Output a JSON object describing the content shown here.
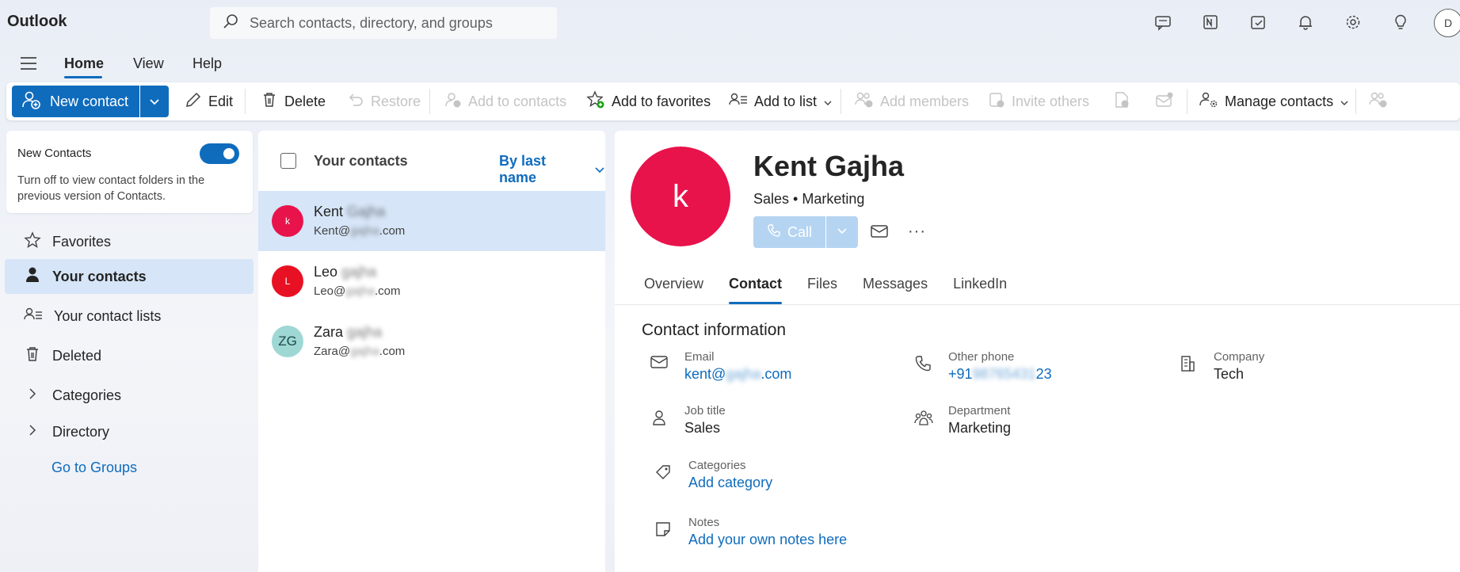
{
  "app": {
    "title": "Outlook"
  },
  "search": {
    "placeholder": "Search contacts, directory, and groups"
  },
  "topbar": {
    "icons": [
      "feedback-icon",
      "onenote-icon",
      "tasks-icon",
      "bell-icon",
      "gear-icon",
      "lightbulb-icon"
    ],
    "avatar_initial": "D"
  },
  "menu": {
    "tabs": [
      "Home",
      "View",
      "Help"
    ],
    "active": "Home"
  },
  "ribbon": {
    "new_contact": "New contact",
    "edit": "Edit",
    "delete": "Delete",
    "restore": "Restore",
    "add_to_contacts": "Add to contacts",
    "add_to_favorites": "Add to favorites",
    "add_to_list": "Add to list",
    "add_members": "Add members",
    "invite_others": "Invite others",
    "manage_contacts": "Manage contacts"
  },
  "left": {
    "new_contacts_title": "New Contacts",
    "new_contacts_desc": "Turn off to view contact folders in the previous version of Contacts.",
    "toggle_on": true,
    "nav": [
      {
        "label": "Favorites",
        "icon": "star-icon"
      },
      {
        "label": "Your contacts",
        "icon": "person-icon",
        "active": true
      },
      {
        "label": "Your contact lists",
        "icon": "people-list-icon"
      },
      {
        "label": "Deleted",
        "icon": "trash-icon"
      },
      {
        "label": "Categories",
        "icon": "chevron-right-icon"
      },
      {
        "label": "Directory",
        "icon": "chevron-right-icon"
      }
    ],
    "groups_link": "Go to Groups"
  },
  "list": {
    "title": "Your contacts",
    "sort": "By last name",
    "contacts": [
      {
        "initials": "k",
        "first": "Kent",
        "last": "Gajha",
        "email_user": "Kent@",
        "email_domain": "gajha",
        "email_tld": ".com",
        "color": "#e8134b",
        "selected": true
      },
      {
        "initials": "L",
        "first": "Leo",
        "last": "gajha",
        "email_user": "Leo@",
        "email_domain": "gajha",
        "email_tld": ".com",
        "color": "#e81123"
      },
      {
        "initials": "ZG",
        "first": "Zara",
        "last": "gajha",
        "email_user": "Zara@",
        "email_domain": "gajha",
        "email_tld": ".com",
        "color": "#9fd7d4"
      }
    ]
  },
  "detail": {
    "avatar_initial": "k",
    "name": "Kent Gajha",
    "role": "Sales • Marketing",
    "call": "Call",
    "more": "···",
    "tabs": [
      "Overview",
      "Contact",
      "Files",
      "Messages",
      "LinkedIn"
    ],
    "active_tab": "Contact",
    "section_title": "Contact information",
    "email_label": "Email",
    "email_user": "kent@",
    "email_domain": "gajha",
    "email_tld": ".com",
    "phone_label": "Other phone",
    "phone_prefix": "+91",
    "phone_mid": "98765431",
    "phone_suffix": "23",
    "company_label": "Company",
    "company": "Tech",
    "job_label": "Job title",
    "job": "Sales",
    "dept_label": "Department",
    "dept": "Marketing",
    "categories_label": "Categories",
    "categories_link": "Add category",
    "notes_label": "Notes",
    "notes_link": "Add your own notes here"
  }
}
